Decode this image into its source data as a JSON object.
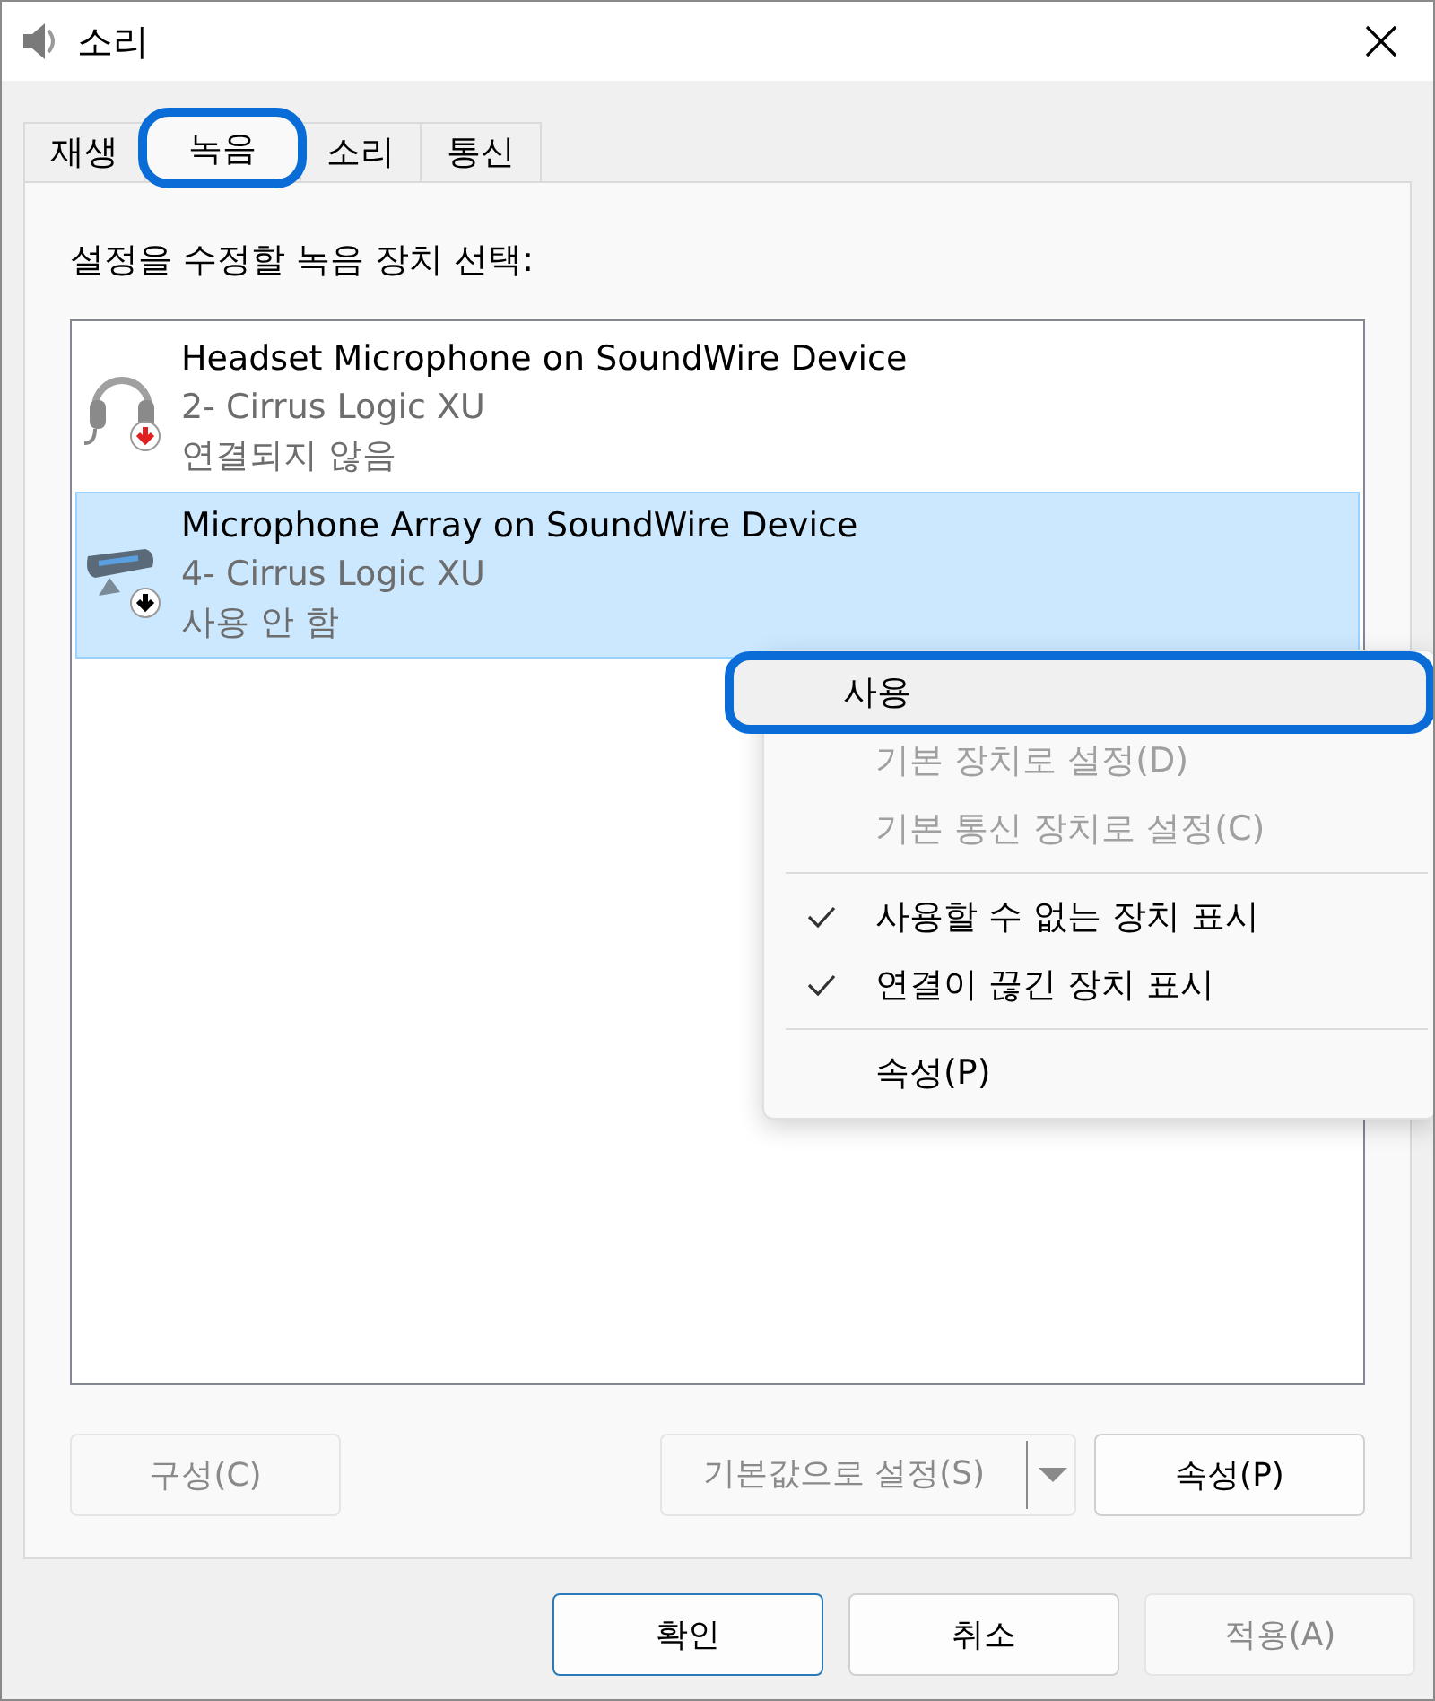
{
  "window": {
    "title": "소리"
  },
  "tabs": [
    {
      "label": "재생",
      "selected": false,
      "highlighted": false
    },
    {
      "label": "녹음",
      "selected": true,
      "highlighted": true
    },
    {
      "label": "소리",
      "selected": false,
      "highlighted": false
    },
    {
      "label": "통신",
      "selected": false,
      "highlighted": false
    }
  ],
  "prompt": "설정을 수정할 녹음 장치 선택:",
  "devices": [
    {
      "kind": "headset",
      "name": "Headset Microphone on SoundWire Device",
      "driver": "2- Cirrus Logic XU",
      "status": "연결되지 않음",
      "selected": false
    },
    {
      "kind": "array",
      "name": "Microphone Array on SoundWire Device",
      "driver": "4- Cirrus Logic XU",
      "status": "사용 안 함",
      "selected": true
    }
  ],
  "context_menu": [
    {
      "kind": "action",
      "label": "사용",
      "disabled": false,
      "highlighted": true
    },
    {
      "kind": "action",
      "label": "기본 장치로 설정(D)",
      "disabled": true,
      "highlighted": false
    },
    {
      "kind": "action",
      "label": "기본 통신 장치로 설정(C)",
      "disabled": true,
      "highlighted": false
    },
    {
      "kind": "separator"
    },
    {
      "kind": "check",
      "label": "사용할 수 없는 장치 표시",
      "checked": true
    },
    {
      "kind": "check",
      "label": "연결이 끊긴 장치 표시",
      "checked": true
    },
    {
      "kind": "separator"
    },
    {
      "kind": "action",
      "label": "속성(P)",
      "disabled": false,
      "highlighted": false
    }
  ],
  "panel_buttons": {
    "configure": {
      "label": "구성(C)",
      "disabled": true
    },
    "set_default": {
      "label": "기본값으로 설정(S)",
      "disabled": true
    },
    "properties": {
      "label": "속성(P)",
      "disabled": false
    }
  },
  "dialog_buttons": [
    {
      "label": "확인",
      "disabled": false,
      "default": true
    },
    {
      "label": "취소",
      "disabled": false,
      "default": false
    },
    {
      "label": "적용(A)",
      "disabled": true,
      "default": false
    }
  ]
}
